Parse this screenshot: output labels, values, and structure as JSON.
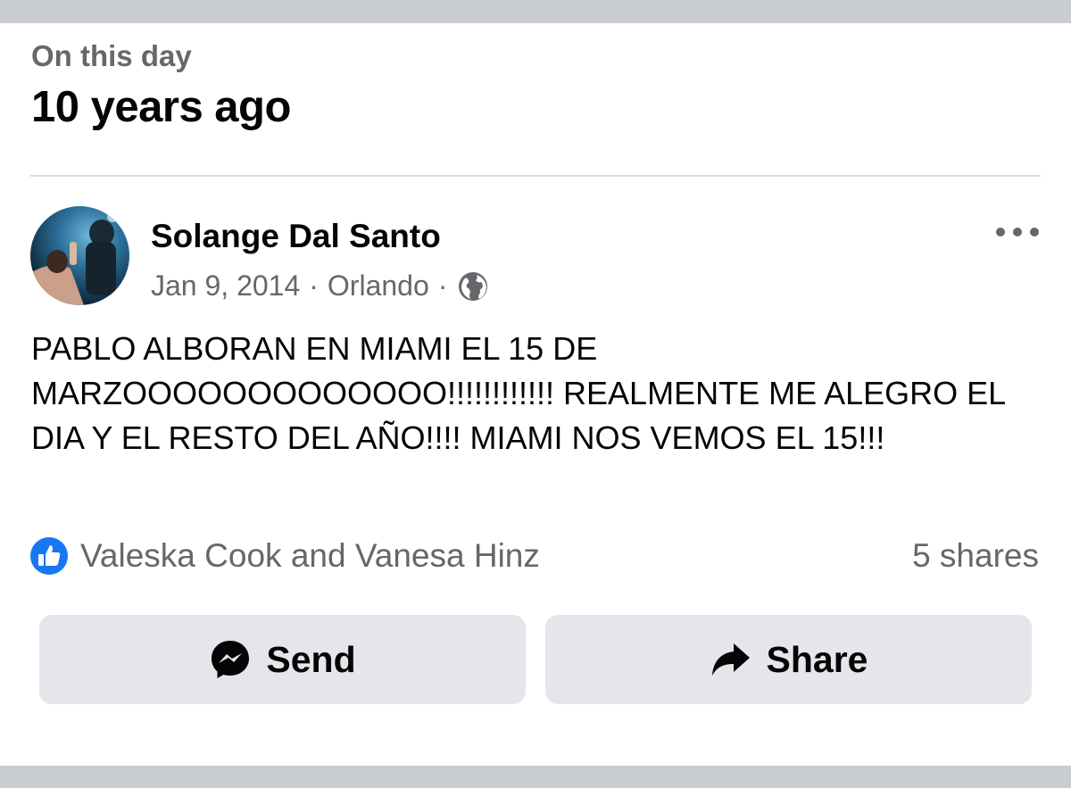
{
  "memory": {
    "label": "On this day",
    "title": "10 years ago"
  },
  "post": {
    "author": "Solange Dal Santo",
    "date": "Jan 9, 2014",
    "separator": "·",
    "location": "Orlando",
    "audience_icon": "globe-icon",
    "text": "PABLO ALBORAN EN MIAMI EL 15 DE MARZOOOOOOOOOOOOO!!!!!!!!!!!! REALMENTE ME ALEGRO EL DIA Y EL RESTO DEL AÑO!!!! MIAMI NOS VEMOS EL 15!!!",
    "more_icon": "more-options-icon"
  },
  "engagement": {
    "reaction_icon": "like-icon",
    "reactions_text": "Valeska Cook and Vanesa Hinz",
    "shares_text": "5 shares"
  },
  "actions": {
    "send_label": "Send",
    "send_icon": "messenger-icon",
    "share_label": "Share",
    "share_icon": "share-arrow-icon"
  },
  "colors": {
    "page_band": "#c9ccd1",
    "primary_text": "#050505",
    "secondary_text": "#65676b",
    "button_bg": "#e4e6eb",
    "like_blue": "#1877f2"
  }
}
